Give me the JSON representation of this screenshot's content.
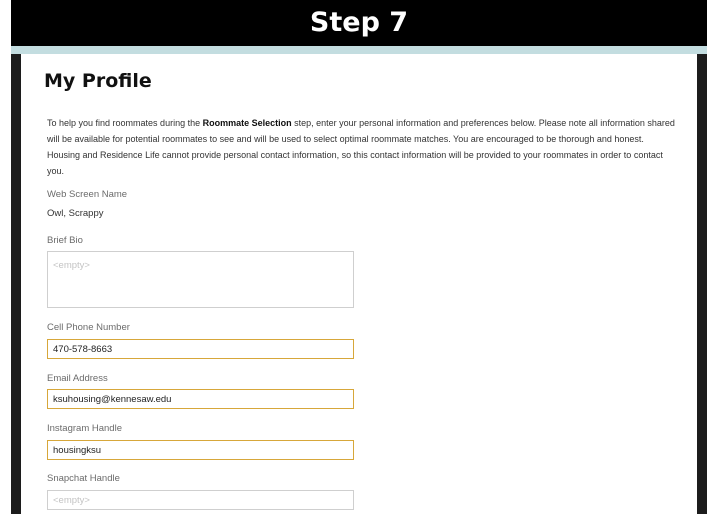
{
  "banner": {
    "title": "Step 7"
  },
  "page": {
    "title": "My Profile",
    "intro_before": "To help you find roommates during the ",
    "intro_bold": "Roommate Selection",
    "intro_after": " step, enter your personal information and preferences below. Please note all information shared will be available for potential roommates to see and will be used to select optimal roommate matches. You are encouraged to be thorough and honest. Housing and Residence Life cannot provide personal contact information, so this contact information will be provided to your roommates in order to contact you."
  },
  "form": {
    "screen_name": {
      "label": "Web Screen Name",
      "value": "Owl, Scrappy"
    },
    "bio": {
      "label": "Brief Bio",
      "value": "",
      "placeholder": "<empty>"
    },
    "phone": {
      "label": "Cell Phone Number",
      "value": "470-578-8663"
    },
    "email": {
      "label": "Email Address",
      "value": "ksuhousing@kennesaw.edu"
    },
    "instagram": {
      "label": "Instagram Handle",
      "value": "housingksu"
    },
    "snapchat": {
      "label": "Snapchat Handle",
      "value": "",
      "placeholder": "<empty>"
    }
  },
  "colors": {
    "banner_bg": "#000000",
    "accent_rule": "#c3dde0",
    "filled_field_border": "#d7a73a"
  }
}
